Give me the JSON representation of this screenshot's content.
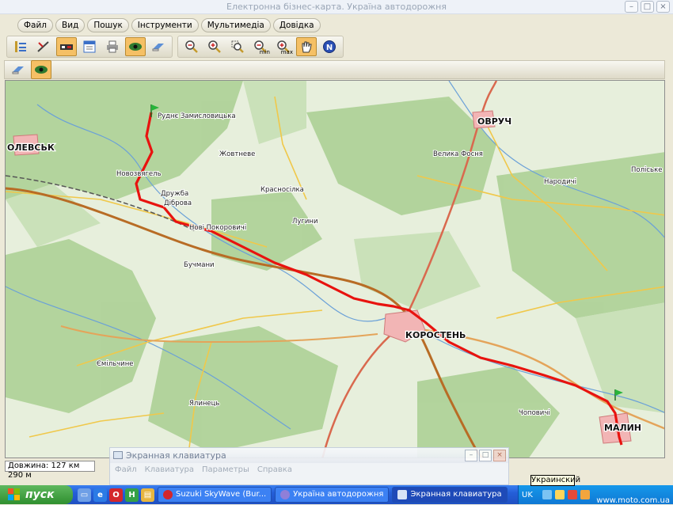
{
  "window": {
    "title": "Електронна бізнес-карта. Україна автодорожня",
    "buttons": {
      "minimize": "–",
      "maximize": "□",
      "close": "×"
    }
  },
  "menu": [
    "Файл",
    "Вид",
    "Пошук",
    "Інструменти",
    "Мультимедіа",
    "Довідка"
  ],
  "toolbar": {
    "icons": [
      "layers-icon",
      "ruler-icon",
      "route-icon",
      "table-icon",
      "print-icon",
      "eye-icon",
      "eraser-icon"
    ],
    "zoom_icons": [
      "zoom-out-icon",
      "zoom-in-icon",
      "zoom-rect-icon",
      "zoom-min-icon",
      "zoom-max-icon",
      "pan-hand-icon",
      "north-icon"
    ],
    "zoom_min_label": "min",
    "zoom_max_label": "max",
    "north_label": "N"
  },
  "map": {
    "cities": [
      "ОЛЕВСЬК",
      "ОВРУЧ",
      "КОРОСТЕНЬ",
      "МАЛИН"
    ],
    "towns": [
      "Новозвягель",
      "Дружба",
      "Діброва",
      "Нові Покоровичі",
      "Жовтневе",
      "Лугини",
      "Бучмани",
      "Ємільчине",
      "Ялинець",
      "Народичі",
      "Поліське",
      "Чоповичі",
      "Руднє Замисловицька",
      "Велика Фосня",
      "Красносілка"
    ],
    "route_color": "#e8130f",
    "flag_color": "#27b43a"
  },
  "status": {
    "length": "Довжина: 127 км 290 м"
  },
  "keyboard_window": {
    "title": "Экранная клавиатура",
    "menu": [
      "Файл",
      "Клавиатура",
      "Параметры",
      "Справка"
    ]
  },
  "tooltip": "Украинский",
  "taskbar": {
    "start": "пуск",
    "tasks": [
      "Suzuki SkyWave (Bur...",
      "Україна автодорожня",
      "Экранная клавиатура"
    ],
    "lang": "UK",
    "watermark": "www.moto.com.ua"
  }
}
